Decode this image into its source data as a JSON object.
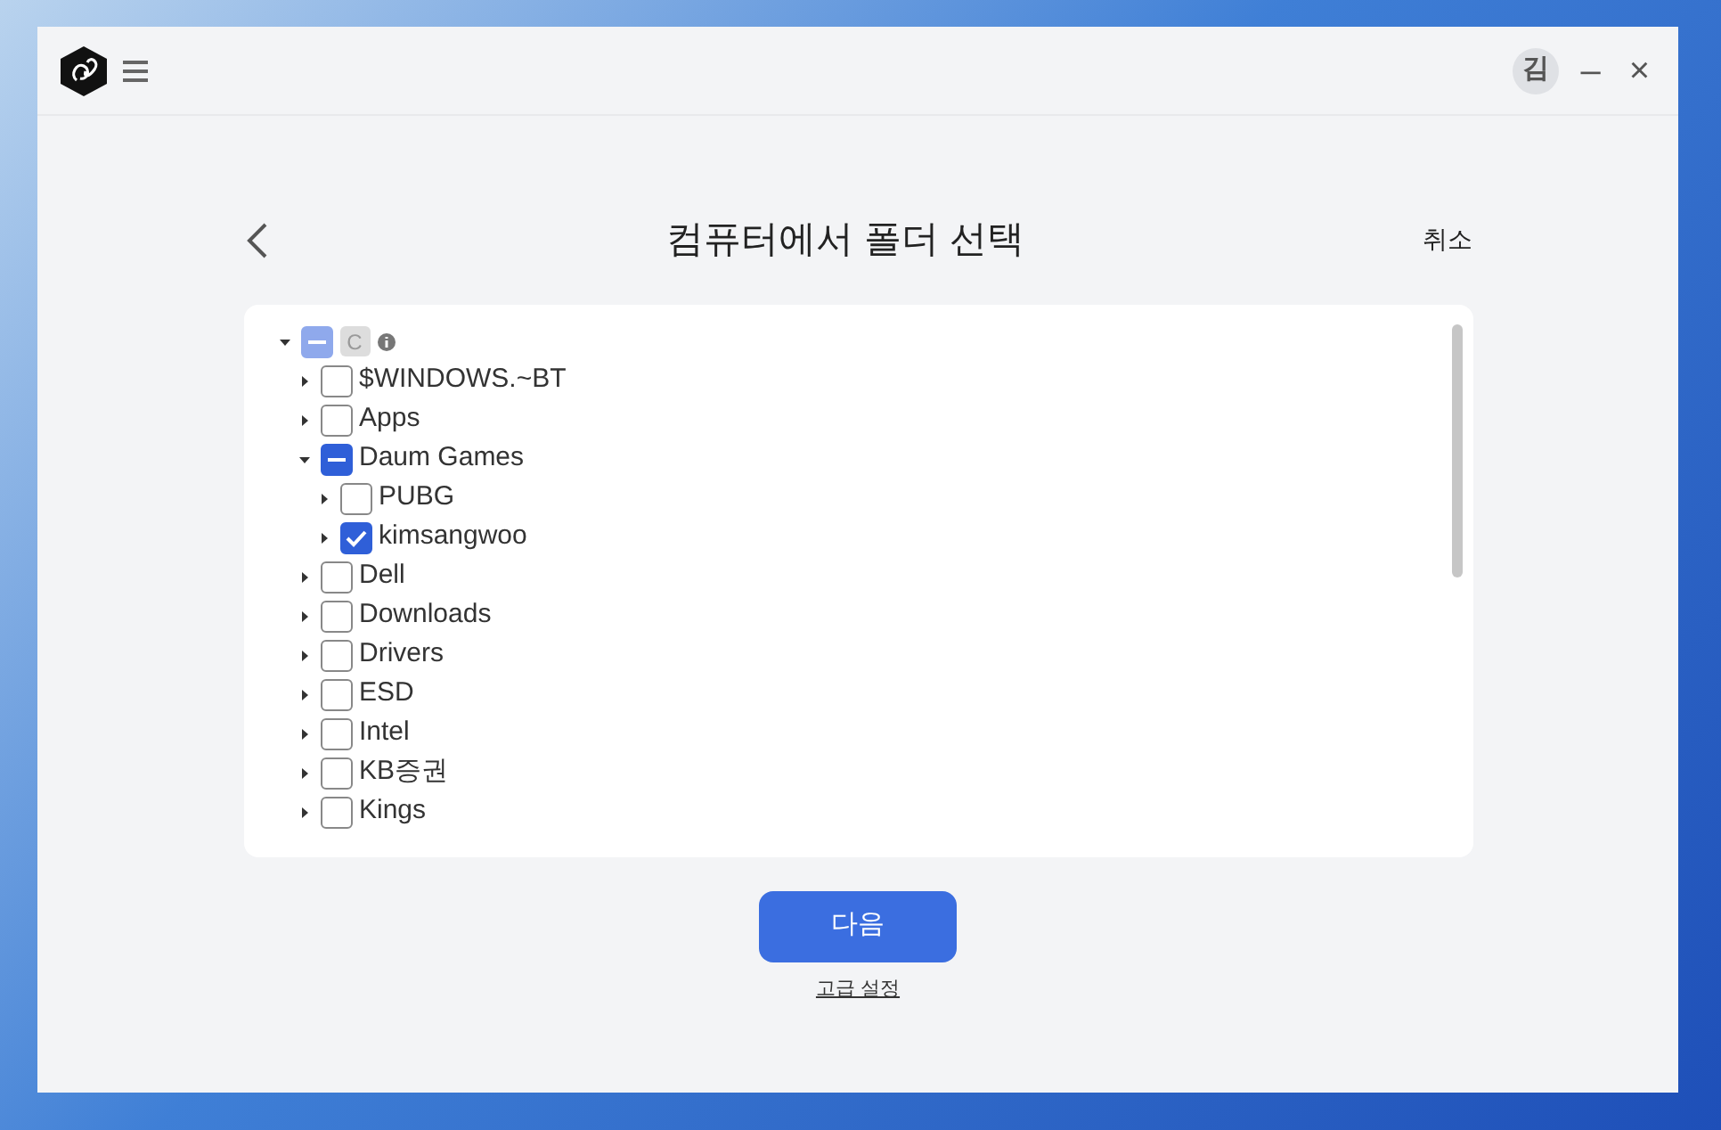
{
  "window": {
    "avatar": "김",
    "minimize": "–",
    "close": "×"
  },
  "header": {
    "title": "컴퓨터에서 폴더 선택",
    "cancel": "취소"
  },
  "tree": {
    "root": {
      "label": "C",
      "checked": false,
      "partial": true,
      "expanded": true,
      "children": [
        {
          "label": "$WINDOWS.~BT",
          "checked": false,
          "partial": false,
          "expanded": false
        },
        {
          "label": "Apps",
          "checked": false,
          "partial": false,
          "expanded": false
        },
        {
          "label": "Daum Games",
          "checked": false,
          "partial": true,
          "expanded": true,
          "children": [
            {
              "label": "PUBG",
              "checked": false,
              "partial": false,
              "expanded": false
            },
            {
              "label": "kimsangwoo",
              "checked": true,
              "partial": false,
              "expanded": false
            }
          ]
        },
        {
          "label": "Dell",
          "checked": false,
          "partial": false,
          "expanded": false
        },
        {
          "label": "Downloads",
          "checked": false,
          "partial": false,
          "expanded": false
        },
        {
          "label": "Drivers",
          "checked": false,
          "partial": false,
          "expanded": false
        },
        {
          "label": "ESD",
          "checked": false,
          "partial": false,
          "expanded": false
        },
        {
          "label": "Intel",
          "checked": false,
          "partial": false,
          "expanded": false
        },
        {
          "label": "KB증권",
          "checked": false,
          "partial": false,
          "expanded": false
        },
        {
          "label": "Kings",
          "checked": false,
          "partial": false,
          "expanded": false
        }
      ]
    }
  },
  "next_button": "다음",
  "advanced_link": "고급 설정"
}
